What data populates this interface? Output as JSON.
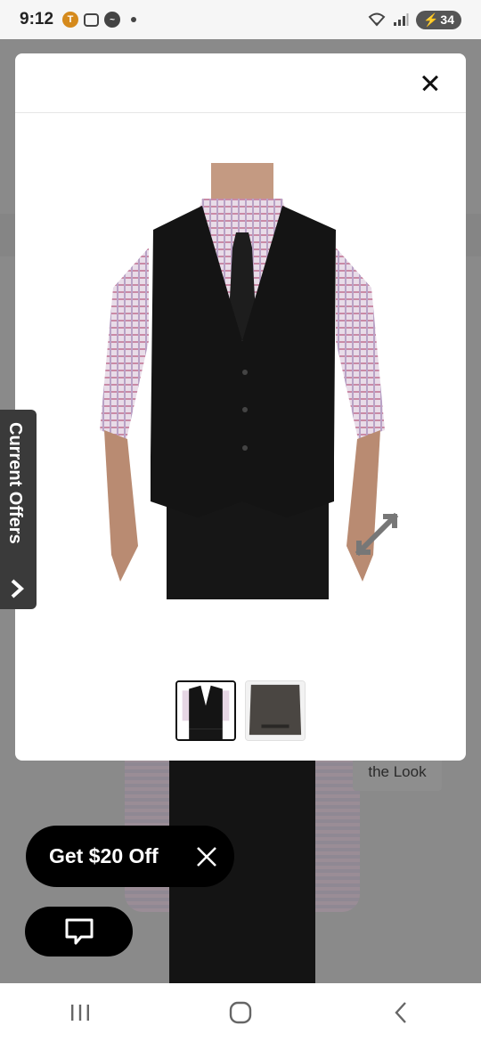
{
  "status_bar": {
    "time": "9:12",
    "notification_icons": [
      "t-app-icon",
      "screenshot-icon",
      "messenger-icon",
      "dot-icon"
    ],
    "battery_level": "34"
  },
  "modal": {
    "close_label": "close",
    "thumbnails": [
      {
        "name": "vest-front",
        "selected": true
      },
      {
        "name": "vest-back",
        "selected": false
      }
    ]
  },
  "background": {
    "complete_look_text": "the Look"
  },
  "offers_tab": {
    "label": "Current Offers"
  },
  "promo": {
    "label": "Get $20 Off"
  },
  "nav": {
    "items": [
      "recents",
      "home",
      "back"
    ]
  },
  "colors": {
    "vest": "#141414",
    "promo_bg": "#000000",
    "offers_tab_bg": "#3a3a3a"
  }
}
